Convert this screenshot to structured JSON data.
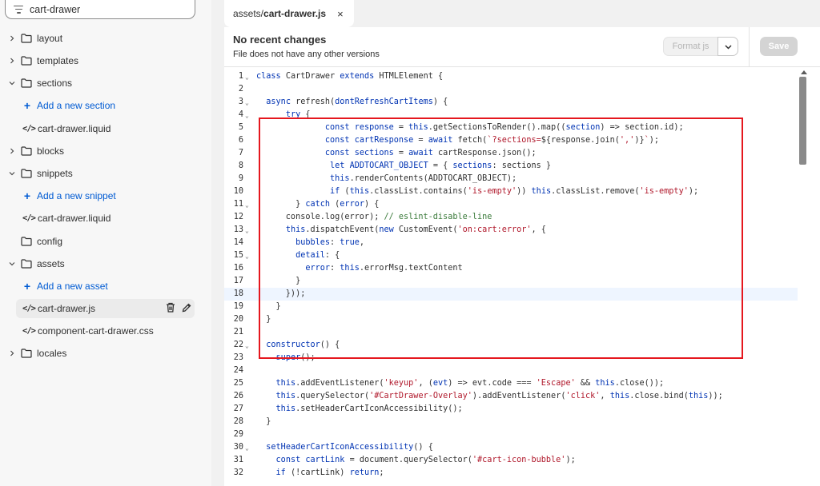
{
  "sidebar": {
    "search_value": "cart-drawer",
    "items": [
      {
        "label": "layout"
      },
      {
        "label": "templates"
      },
      {
        "label": "sections"
      },
      {
        "label": "Add a new section"
      },
      {
        "label": "cart-drawer.liquid"
      },
      {
        "label": "blocks"
      },
      {
        "label": "snippets"
      },
      {
        "label": "Add a new snippet"
      },
      {
        "label": "cart-drawer.liquid"
      },
      {
        "label": "config"
      },
      {
        "label": "assets"
      },
      {
        "label": "Add a new asset"
      },
      {
        "label": "cart-drawer.js"
      },
      {
        "label": "component-cart-drawer.css"
      },
      {
        "label": "locales"
      }
    ]
  },
  "tab": {
    "path": "assets/",
    "name": "cart-drawer.js",
    "close": "×"
  },
  "info": {
    "title": "No recent changes",
    "subtitle": "File does not have any other versions",
    "format_label": "Format js",
    "save_label": "Save"
  },
  "editor": {
    "line_numbers": [
      "1",
      "2",
      "3",
      "4",
      "5",
      "6",
      "7",
      "8",
      "9",
      "10",
      "11",
      "12",
      "13",
      "14",
      "15",
      "16",
      "17",
      "18",
      "19",
      "20",
      "21",
      "22",
      "23",
      "24",
      "25",
      "26",
      "27",
      "28",
      "29",
      "30",
      "31",
      "32"
    ],
    "active_line": "18"
  },
  "colors": {
    "highlight": "#e5171e",
    "link": "#005bd3"
  }
}
